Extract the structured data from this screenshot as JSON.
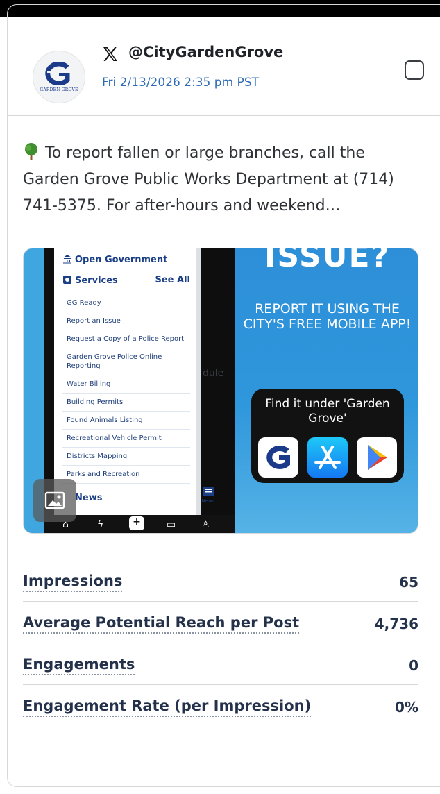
{
  "header": {
    "handle": "@CityGardenGrove",
    "timestamp": "Fri 2/13/2026 2:35 pm PST",
    "avatar_caption": "GARDEN GROVE"
  },
  "post": {
    "text": "To report fallen or large branches, call the Garden Grove Public Works Department at (714) 741-5375. For after-hours and weekend…"
  },
  "media": {
    "menu_heading_1": "Open Government",
    "menu_heading_2": "Services",
    "see_all": "See All",
    "menu_items": [
      "GG Ready",
      "Report an Issue",
      "Request a Copy of a Police Report",
      "Garden Grove Police Online Reporting",
      "Water Billing",
      "Building Permits",
      "Found Animals Listing",
      "Recreational Vehicle Permit",
      "Districts Mapping",
      "Parks and Recreation"
    ],
    "menu_heading_3": "News",
    "behind_text": "dule",
    "news_tab": "News",
    "headline": "ISSUE?",
    "report_line": "REPORT IT USING THE CITY'S FREE MOBILE APP!",
    "find_line": "Find it under 'Garden Grove'"
  },
  "metrics": [
    {
      "label": "Impressions",
      "value": "65"
    },
    {
      "label": "Average Potential Reach per Post",
      "value": "4,736"
    },
    {
      "label": "Engagements",
      "value": "0"
    },
    {
      "label": "Engagement Rate (per Impression)",
      "value": "0%"
    }
  ],
  "colors": {
    "link": "#2d6bb5",
    "metric_text": "#24314a",
    "media_blue": "#2f97dc"
  }
}
